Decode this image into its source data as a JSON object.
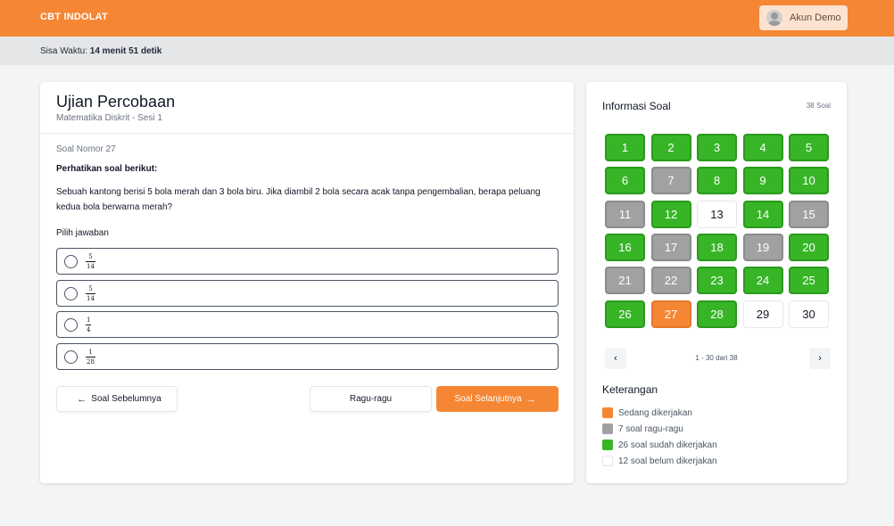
{
  "header": {
    "brand": "CBT INDOLAT",
    "account_label": "Akun Demo"
  },
  "timer": {
    "label": "Sisa Waktu:",
    "value": "14 menit 51 detik"
  },
  "exam": {
    "title": "Ujian Percobaan",
    "subtitle": "Matematika Diskrit - Sesi 1",
    "question_number": "Soal Nomor 27",
    "intro": "Perhatikan soal berikut:",
    "text": "Sebuah kantong berisi 5 bola merah dan 3 bola biru. Jika diambil 2 bola secara acak tanpa pengembalian, berapa peluang kedua bola berwarna merah?",
    "choose_label": "Pilih jawaban",
    "options": [
      {
        "num": "5",
        "den": "14"
      },
      {
        "num": "5",
        "den": "14"
      },
      {
        "num": "1",
        "den": "4"
      },
      {
        "num": "1",
        "den": "28"
      }
    ]
  },
  "actions": {
    "prev_label": "Soal Sebelumnya",
    "doubt_label": "Ragu-ragu",
    "next_label": "Soal Selanjutnya"
  },
  "info": {
    "title": "Informasi Soal",
    "count": "38 Soal",
    "questions": [
      {
        "n": "1",
        "status": "answered"
      },
      {
        "n": "2",
        "status": "answered"
      },
      {
        "n": "3",
        "status": "answered"
      },
      {
        "n": "4",
        "status": "answered"
      },
      {
        "n": "5",
        "status": "answered"
      },
      {
        "n": "6",
        "status": "answered"
      },
      {
        "n": "7",
        "status": "doubt"
      },
      {
        "n": "8",
        "status": "answered"
      },
      {
        "n": "9",
        "status": "answered"
      },
      {
        "n": "10",
        "status": "answered"
      },
      {
        "n": "11",
        "status": "doubt"
      },
      {
        "n": "12",
        "status": "answered"
      },
      {
        "n": "13",
        "status": "unanswered"
      },
      {
        "n": "14",
        "status": "answered"
      },
      {
        "n": "15",
        "status": "doubt"
      },
      {
        "n": "16",
        "status": "answered"
      },
      {
        "n": "17",
        "status": "doubt"
      },
      {
        "n": "18",
        "status": "answered"
      },
      {
        "n": "19",
        "status": "doubt"
      },
      {
        "n": "20",
        "status": "answered"
      },
      {
        "n": "21",
        "status": "doubt"
      },
      {
        "n": "22",
        "status": "doubt"
      },
      {
        "n": "23",
        "status": "answered"
      },
      {
        "n": "24",
        "status": "answered"
      },
      {
        "n": "25",
        "status": "answered"
      },
      {
        "n": "26",
        "status": "answered"
      },
      {
        "n": "27",
        "status": "current"
      },
      {
        "n": "28",
        "status": "answered"
      },
      {
        "n": "29",
        "status": "unanswered"
      },
      {
        "n": "30",
        "status": "unanswered"
      }
    ],
    "pager_text": "1 - 30 dari 38",
    "legend_title": "Keterangan",
    "legend": [
      {
        "color": "orange",
        "label": "Sedang dikerjakan"
      },
      {
        "color": "gray",
        "label": "7 soal ragu-ragu"
      },
      {
        "color": "green",
        "label": "26 soal sudah dikerjakan"
      },
      {
        "color": "white",
        "label": "12 soal belum dikerjakan"
      }
    ]
  },
  "colors": {
    "accent": "#f58634",
    "answered": "#37b527",
    "doubt": "#a0a1a3"
  }
}
